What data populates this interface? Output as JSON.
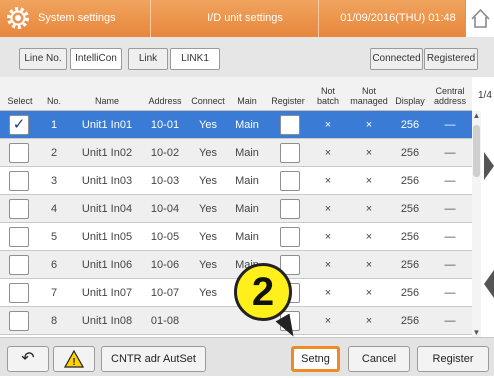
{
  "titlebar": {
    "app_title": "System settings",
    "screen_title": "I/D unit settings",
    "datetime": "01/09/2016(THU) 01:48"
  },
  "filter": {
    "line_label": "Line No.",
    "line_value": "IntelliCon",
    "link_label": "Link",
    "link_value": "LINK1",
    "connected_label": "Connected",
    "registered_label": "Registered"
  },
  "table": {
    "headers": {
      "select": "Select",
      "no": "No.",
      "name": "Name",
      "address": "Address",
      "connect": "Connect",
      "main": "Main",
      "register": "Register",
      "not_batch_1": "Not",
      "not_batch_2": "batch",
      "not_managed_1": "Not",
      "not_managed_2": "managed",
      "display": "Display",
      "central_1": "Central",
      "central_2": "address"
    },
    "page_indicator": "1/4",
    "rows": [
      {
        "no": "1",
        "name": "Unit1 In01",
        "address": "10-01",
        "connect": "Yes",
        "main": "Main",
        "not_batch": "×",
        "not_managed": "×",
        "display": "256",
        "central": "—",
        "checked": "✓"
      },
      {
        "no": "2",
        "name": "Unit1 In02",
        "address": "10-02",
        "connect": "Yes",
        "main": "Main",
        "not_batch": "×",
        "not_managed": "×",
        "display": "256",
        "central": "—",
        "checked": ""
      },
      {
        "no": "3",
        "name": "Unit1 In03",
        "address": "10-03",
        "connect": "Yes",
        "main": "Main",
        "not_batch": "×",
        "not_managed": "×",
        "display": "256",
        "central": "—",
        "checked": ""
      },
      {
        "no": "4",
        "name": "Unit1 In04",
        "address": "10-04",
        "connect": "Yes",
        "main": "Main",
        "not_batch": "×",
        "not_managed": "×",
        "display": "256",
        "central": "—",
        "checked": ""
      },
      {
        "no": "5",
        "name": "Unit1 In05",
        "address": "10-05",
        "connect": "Yes",
        "main": "Main",
        "not_batch": "×",
        "not_managed": "×",
        "display": "256",
        "central": "—",
        "checked": ""
      },
      {
        "no": "6",
        "name": "Unit1 In06",
        "address": "10-06",
        "connect": "Yes",
        "main": "Main",
        "not_batch": "×",
        "not_managed": "×",
        "display": "256",
        "central": "—",
        "checked": ""
      },
      {
        "no": "7",
        "name": "Unit1 In07",
        "address": "10-07",
        "connect": "Yes",
        "main": "",
        "not_batch": "×",
        "not_managed": "×",
        "display": "256",
        "central": "—",
        "checked": ""
      },
      {
        "no": "8",
        "name": "Unit1 In08",
        "address": "01-08",
        "connect": "",
        "main": "",
        "not_batch": "×",
        "not_managed": "×",
        "display": "256",
        "central": "—",
        "checked": ""
      }
    ]
  },
  "bottom": {
    "back_icon": "↶",
    "warning_icon": "!",
    "cntr_label": "CNTR adr AutSet",
    "setng_label": "Setng",
    "cancel_label": "Cancel",
    "register_label": "Register"
  },
  "callout": {
    "number": "2"
  },
  "colors": {
    "titlebar": "#e8863c",
    "selected_row": "#3a7bd5",
    "highlight": "#f08a25",
    "callout": "#ffef1a"
  }
}
